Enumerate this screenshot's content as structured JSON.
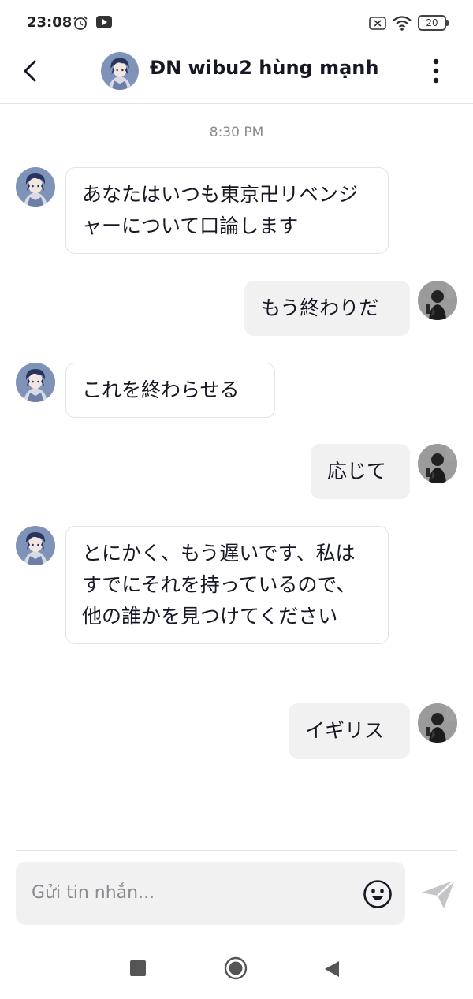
{
  "status_bar": {
    "time": "23:08",
    "battery": "20",
    "icons": [
      "alarm-icon",
      "youtube-icon",
      "sim-off-icon",
      "wifi-icon",
      "battery-icon"
    ]
  },
  "header": {
    "title": "ĐN wibu2 hùng mạnh",
    "back_icon": "chevron-left-icon",
    "more_icon": "more-vertical-icon"
  },
  "chat": {
    "timestamp": "8:30 PM",
    "messages": [
      {
        "side": "in",
        "text": "あなたはいつも東京卍リベンジャーについて口論します"
      },
      {
        "side": "out",
        "text": "もう終わりだ"
      },
      {
        "side": "in",
        "text": "これを終わらせる"
      },
      {
        "side": "out",
        "text": "応じて"
      },
      {
        "side": "in",
        "text": "とにかく、もう遅いです、私はすでにそれを持っているので、他の誰かを見つけてください"
      },
      {
        "side": "out",
        "text": "イギリス"
      }
    ]
  },
  "composer": {
    "placeholder": "Gửi tin nhắn...",
    "emoji_icon": "emoji-icon",
    "send_icon": "send-icon"
  },
  "nav_bar": {
    "icons": [
      "recent-apps-icon",
      "home-icon",
      "back-icon"
    ]
  },
  "colors": {
    "outgoing_bubble": "#f1f1f2",
    "incoming_border": "#e3e3e4",
    "text_primary": "#161823",
    "text_secondary": "#8a8b91"
  }
}
